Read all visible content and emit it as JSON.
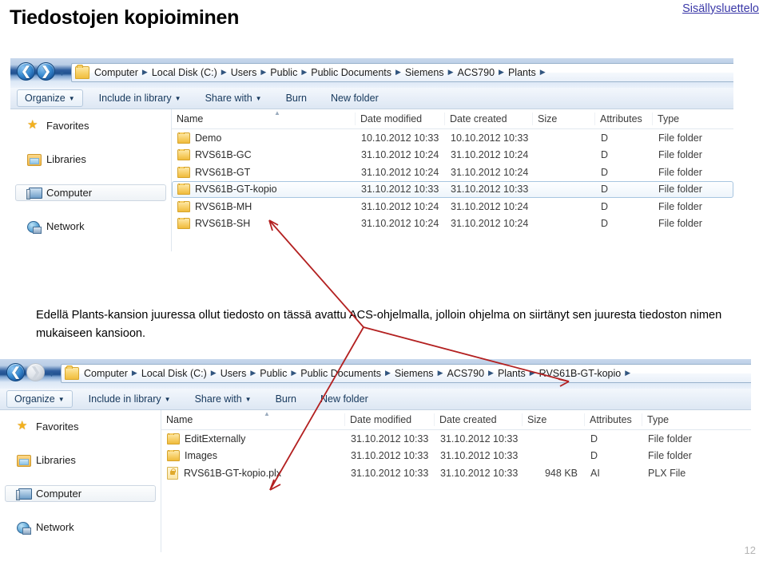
{
  "slide": {
    "title": "Tiedostojen kopioiminen",
    "toc_link": "Sisällysluettelo",
    "page_number": "12",
    "caption": "Edellä Plants-kansion juuressa ollut tiedosto on tässä avattu ACS-ohjelmalla, jolloin ohjelma on siirtänyt sen juuresta tiedoston nimen mukaiseen kansioon.",
    "annotation_color": "#b32020"
  },
  "nav_pane": {
    "items": [
      {
        "label": "Favorites",
        "icon": "star-icon",
        "selected": false
      },
      {
        "label": "Libraries",
        "icon": "libraries-icon",
        "selected": false
      },
      {
        "label": "Computer",
        "icon": "computer-icon",
        "selected": true
      },
      {
        "label": "Network",
        "icon": "network-icon",
        "selected": false
      }
    ]
  },
  "columns": {
    "name": "Name",
    "date_modified": "Date modified",
    "date_created": "Date created",
    "size": "Size",
    "attributes": "Attributes",
    "type": "Type"
  },
  "toolbar": {
    "organize": "Organize",
    "include_in_library": "Include in library",
    "share_with": "Share with",
    "burn": "Burn",
    "new_folder": "New folder"
  },
  "window_top": {
    "back_enabled": true,
    "forward_enabled": true,
    "breadcrumbs": [
      "Computer",
      "Local Disk (C:)",
      "Users",
      "Public",
      "Public Documents",
      "Siemens",
      "ACS790",
      "Plants"
    ],
    "rows": [
      {
        "name": "Demo",
        "date_modified": "10.10.2012 10:33",
        "date_created": "10.10.2012 10:33",
        "size": "",
        "attributes": "D",
        "type": "File folder",
        "icon": "folder-icon",
        "selected": false
      },
      {
        "name": "RVS61B-GC",
        "date_modified": "31.10.2012 10:24",
        "date_created": "31.10.2012 10:24",
        "size": "",
        "attributes": "D",
        "type": "File folder",
        "icon": "folder-icon",
        "selected": false
      },
      {
        "name": "RVS61B-GT",
        "date_modified": "31.10.2012 10:24",
        "date_created": "31.10.2012 10:24",
        "size": "",
        "attributes": "D",
        "type": "File folder",
        "icon": "folder-icon",
        "selected": false
      },
      {
        "name": "RVS61B-GT-kopio",
        "date_modified": "31.10.2012 10:33",
        "date_created": "31.10.2012 10:33",
        "size": "",
        "attributes": "D",
        "type": "File folder",
        "icon": "folder-icon",
        "selected": true
      },
      {
        "name": "RVS61B-MH",
        "date_modified": "31.10.2012 10:24",
        "date_created": "31.10.2012 10:24",
        "size": "",
        "attributes": "D",
        "type": "File folder",
        "icon": "folder-icon",
        "selected": false
      },
      {
        "name": "RVS61B-SH",
        "date_modified": "31.10.2012 10:24",
        "date_created": "31.10.2012 10:24",
        "size": "",
        "attributes": "D",
        "type": "File folder",
        "icon": "folder-icon",
        "selected": false
      }
    ]
  },
  "window_bottom": {
    "back_enabled": true,
    "forward_enabled": false,
    "breadcrumbs": [
      "Computer",
      "Local Disk (C:)",
      "Users",
      "Public",
      "Public Documents",
      "Siemens",
      "ACS790",
      "Plants",
      "RVS61B-GT-kopio"
    ],
    "rows": [
      {
        "name": "EditExternally",
        "date_modified": "31.10.2012 10:33",
        "date_created": "31.10.2012 10:33",
        "size": "",
        "attributes": "D",
        "type": "File folder",
        "icon": "folder-icon",
        "selected": false
      },
      {
        "name": "Images",
        "date_modified": "31.10.2012 10:33",
        "date_created": "31.10.2012 10:33",
        "size": "",
        "attributes": "D",
        "type": "File folder",
        "icon": "folder-icon",
        "selected": false
      },
      {
        "name": "RVS61B-GT-kopio.plx",
        "date_modified": "31.10.2012 10:33",
        "date_created": "31.10.2012 10:33",
        "size": "948 KB",
        "attributes": "AI",
        "type": "PLX File",
        "icon": "plx-file-icon",
        "selected": false
      }
    ]
  }
}
